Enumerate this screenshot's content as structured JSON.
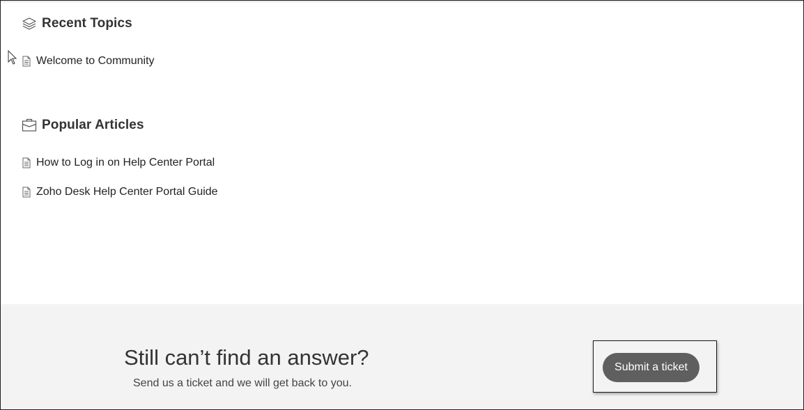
{
  "recent_topics": {
    "title": "Recent Topics",
    "icon": "layers-icon",
    "items": [
      {
        "label": "Welcome to Community"
      }
    ]
  },
  "popular_articles": {
    "title": "Popular Articles",
    "icon": "briefcase-icon",
    "items": [
      {
        "label": "How to Log in on Help Center Portal"
      },
      {
        "label": "Zoho Desk Help Center Portal Guide"
      }
    ]
  },
  "footer": {
    "title": "Still can’t find an answer?",
    "subtitle": "Send us a ticket and we will get back to you.",
    "submit_label": "Submit a ticket"
  },
  "colors": {
    "footer_background": "#f3f3f3",
    "button_background": "#5f5f5f",
    "text": "#333333"
  }
}
